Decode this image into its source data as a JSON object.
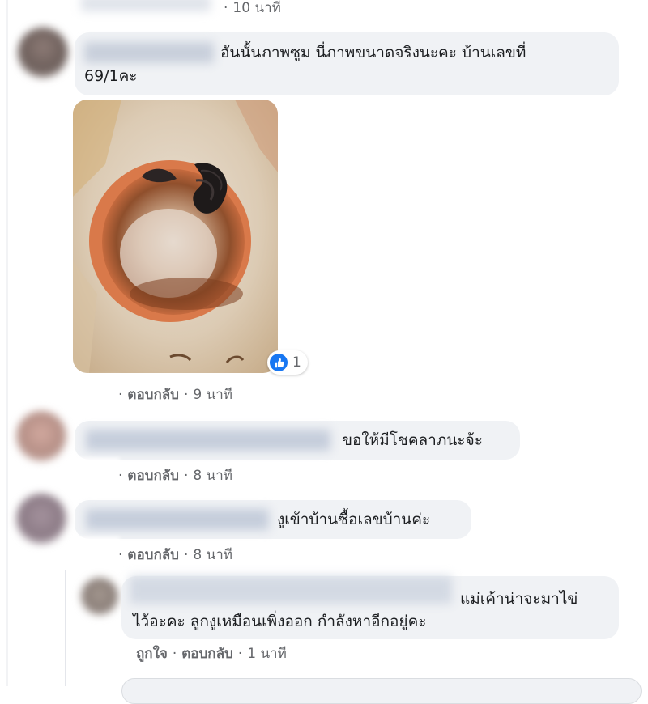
{
  "top": {
    "time": "10 นาที"
  },
  "comments": [
    {
      "text_line1": "อันนั้นภาพซูม นี่ภาพขนาดจริงนะคะ บ้านเลขที่",
      "text_line2": "69/1คะ",
      "reaction_count": "1",
      "reply_label": "ตอบกลับ",
      "time": "9 นาที"
    },
    {
      "text": "ขอให้มีโชคลาภนะจ้ะ",
      "reply_label": "ตอบกลับ",
      "time": "8 นาที"
    },
    {
      "text": "งูเข้าบ้านซื้อเลขบ้านค่ะ",
      "reply_label": "ตอบกลับ",
      "time": "8 นาที"
    }
  ],
  "reply": {
    "text_line1": "แม่เค้าน่าจะมาไข่",
    "text_line2": "ไว้อะคะ ลูกงูเหมือนเพิ่งออก กำลังหาอีกอยู่คะ",
    "like_label": "ถูกใจ",
    "reply_label": "ตอบกลับ",
    "time": "1 นาที"
  },
  "colors": {
    "bubble": "#f0f2f5",
    "meta": "#65676b",
    "like_blue": "#1877f2"
  }
}
